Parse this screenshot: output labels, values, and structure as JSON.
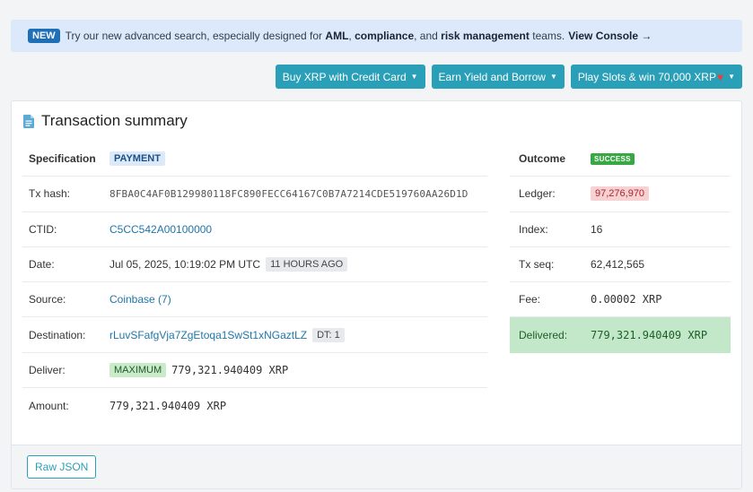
{
  "banner": {
    "badge": "NEW",
    "text_1": "Try our new advanced search, especially designed for",
    "bold_1": "AML",
    "sep_1": ",",
    "bold_2": "compliance",
    "sep_2": ", and",
    "bold_3": "risk management",
    "text_2": "teams.",
    "console_link": "View Console →"
  },
  "top_buttons": [
    {
      "label": "Buy XRP with Credit Card"
    },
    {
      "label": "Earn Yield and Borrow"
    },
    {
      "label": "Play Slots & win 70,000 XRP"
    }
  ],
  "summary": {
    "title": "Transaction summary",
    "left_rows": {
      "specification": {
        "label": "Specification",
        "value": "PAYMENT"
      },
      "tx_hash": {
        "label": "Tx hash:",
        "value": "8FBA0C4AF0B129980118FC890FECC64167C0B7A7214CDE519760AA26D1D"
      },
      "ctid": {
        "label": "CTID:",
        "value": "C5CC542A00100000"
      },
      "date": {
        "label": "Date:",
        "value": "Jul 05, 2025, 10:19:02 PM UTC",
        "badge": "11 HOURS AGO"
      },
      "source": {
        "label": "Source:",
        "value": "Coinbase (7)"
      },
      "destination": {
        "label": "Destination:",
        "value": "rLuvSFafgVja7ZgEtoqa1SwSt1xNGaztLZ",
        "badge": "DT: 1"
      },
      "deliver": {
        "label": "Deliver:",
        "badge": "MAXIMUM",
        "value": "779,321.940409 XRP"
      },
      "amount": {
        "label": "Amount:",
        "value": "779,321.940409 XRP"
      }
    },
    "right_rows": {
      "outcome": {
        "label": "Outcome",
        "value": "SUCCESS"
      },
      "ledger": {
        "label": "Ledger:",
        "value": "97,276,970"
      },
      "index": {
        "label": "Index:",
        "value": "16"
      },
      "tx_seq": {
        "label": "Tx seq:",
        "value": "62,412,565"
      },
      "fee": {
        "label": "Fee:",
        "value": "0.00002 XRP"
      },
      "delivered": {
        "label": "Delivered:",
        "value": "779,321.940409 XRP"
      }
    },
    "raw_json_label": "Raw JSON"
  },
  "colors": {
    "accent": "#2a9fb8",
    "banner_bg": "#dbe9fb",
    "success": "#38a845",
    "delivered_bg": "#c3e8c9"
  }
}
